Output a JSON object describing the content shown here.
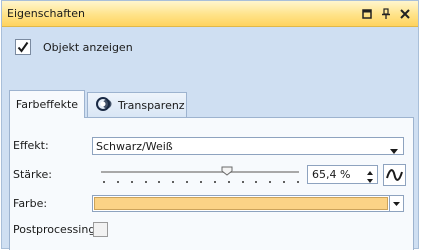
{
  "panel": {
    "title": "Eigenschaften",
    "buttons": [
      "restore-icon",
      "pin-icon",
      "close-icon"
    ]
  },
  "show_object": {
    "label": "Objekt anzeigen",
    "checked": true
  },
  "tabs": [
    {
      "label": "Farbeffekte",
      "active": true
    },
    {
      "label": "Transparenz",
      "icon": "transparency-icon",
      "active": false
    }
  ],
  "effect": {
    "label": "Effekt:",
    "value": "Schwarz/Weiß"
  },
  "strength": {
    "label": "Stärke:",
    "value_text": "65,4 %",
    "slider_fraction": 0.654,
    "tick_count": 15
  },
  "color": {
    "label": "Farbe:",
    "value_hex": "#fbd386"
  },
  "postprocessing": {
    "label": "Postprocessing",
    "checked": false
  },
  "colors": {
    "accent": "#ffd35f",
    "panel_bg": "#cfdff2",
    "tab_bg": "#f7fafd"
  }
}
